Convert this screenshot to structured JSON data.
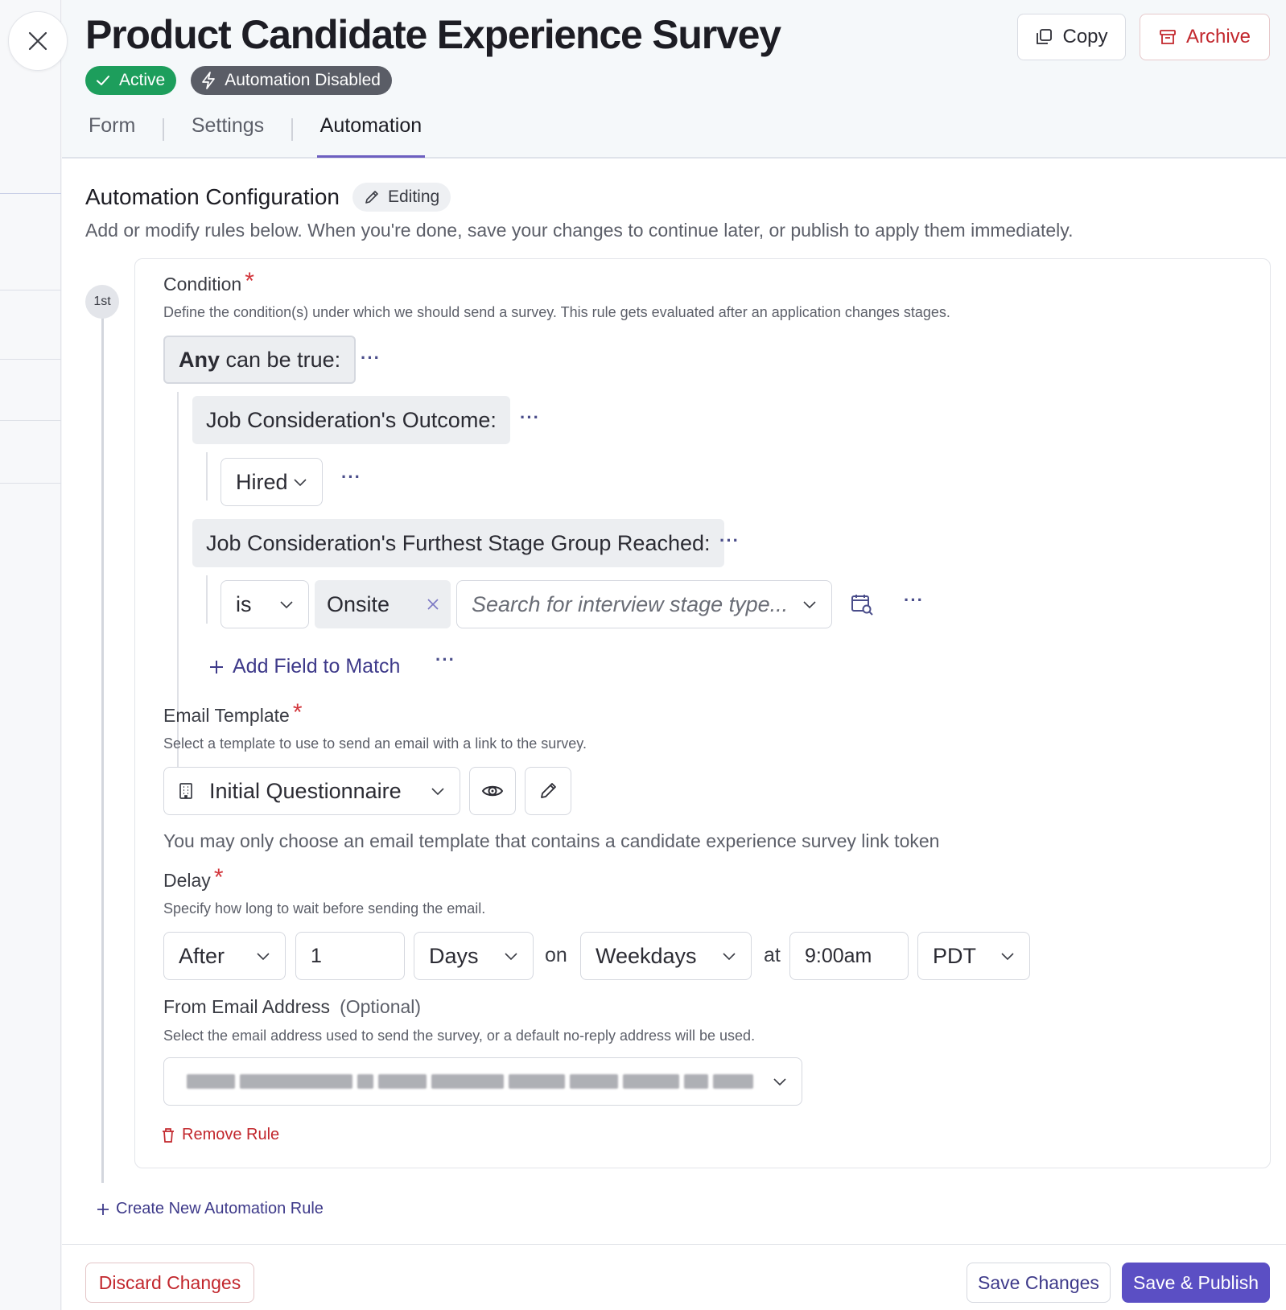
{
  "header": {
    "title": "Product Candidate Experience Survey",
    "status_badge": "Active",
    "automation_badge": "Automation Disabled",
    "copy_label": "Copy",
    "archive_label": "Archive"
  },
  "tabs": [
    {
      "label": "Form"
    },
    {
      "label": "Settings"
    },
    {
      "label": "Automation"
    }
  ],
  "section": {
    "title": "Automation Configuration",
    "editing_chip": "Editing",
    "description": "Add or modify rules below. When you're done, save your changes to continue later, or publish to apply them immediately."
  },
  "rule": {
    "step_label": "1st",
    "condition": {
      "label": "Condition",
      "required_mark": "*",
      "help": "Define the condition(s) under which we should send a survey. This rule gets evaluated after an application changes stages.",
      "group_label_strong": "Any",
      "group_label_rest": " can be true:",
      "field1_label": "Job Consideration's Outcome:",
      "field1_value": "Hired",
      "field2_label": "Job Consideration's Furthest Stage Group Reached:",
      "operator": "is",
      "selected_tag": "Onsite",
      "search_placeholder": "Search for interview stage type...",
      "add_field_label": "Add Field to Match",
      "more_glyph": "···"
    },
    "email_template": {
      "label": "Email Template",
      "required_mark": "*",
      "help": "Select a template to use to send an email with a link to the survey.",
      "value": "Initial Questionnaire",
      "note": "You may only choose an email template that contains a candidate experience survey link token"
    },
    "delay": {
      "label": "Delay",
      "required_mark": "*",
      "help": "Specify how long to wait before sending the email.",
      "when": "After",
      "amount": "1",
      "unit": "Days",
      "on_label": "on",
      "days": "Weekdays",
      "at_label": "at",
      "time": "9:00am",
      "timezone": "PDT"
    },
    "from_email": {
      "label": "From Email Address",
      "optional": "(Optional)",
      "help": "Select the email address used to send the survey, or a default no-reply address will be used."
    },
    "remove_label": "Remove Rule"
  },
  "create_rule_label": "Create New Automation Rule",
  "footer": {
    "discard_label": "Discard Changes",
    "save_label": "Save Changes",
    "publish_label": "Save & Publish"
  },
  "colors": {
    "accent": "#5b4fc4",
    "danger": "#c2272d",
    "active_green": "#1d9e5c",
    "link": "#3e3a8a"
  }
}
